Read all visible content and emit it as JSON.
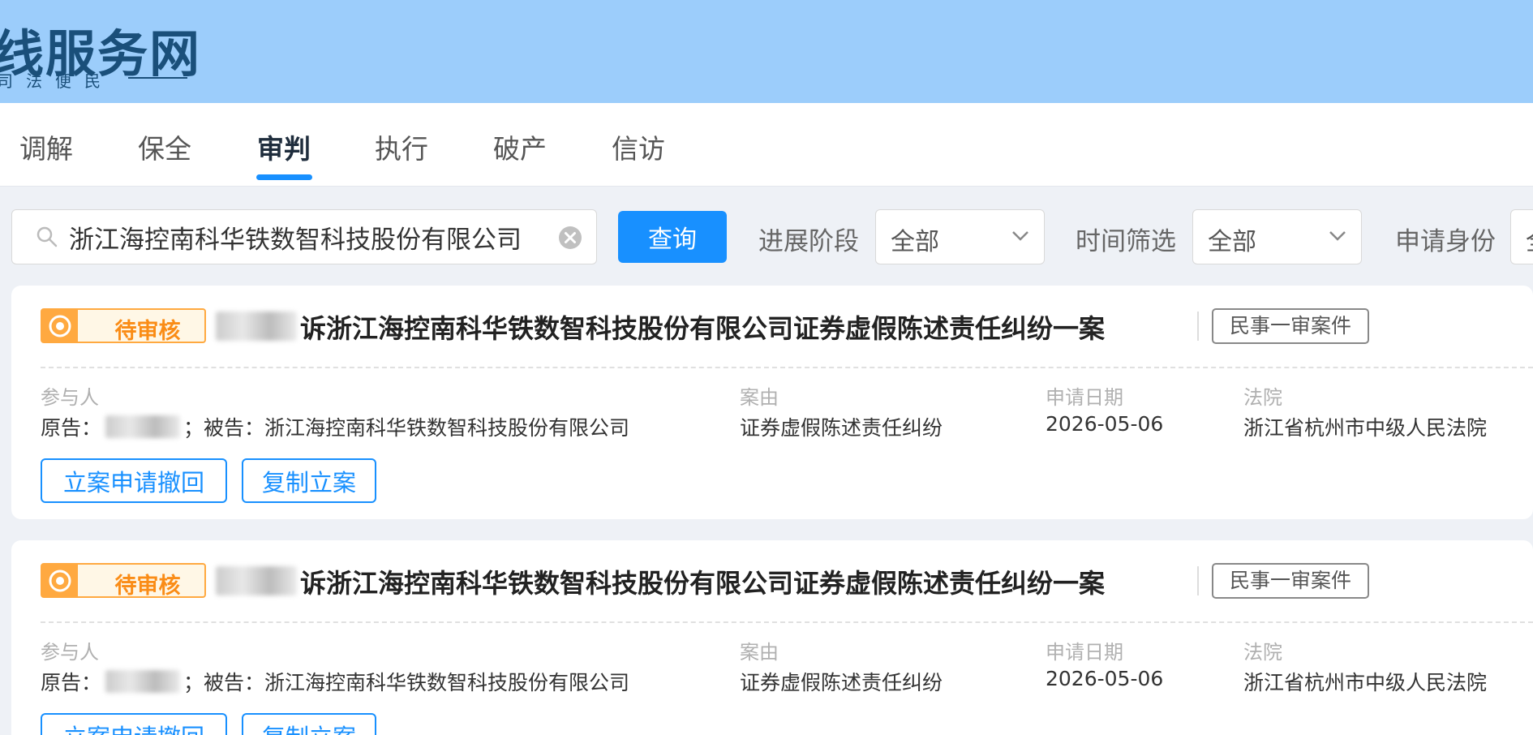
{
  "header": {
    "logo_title": "线服务网",
    "logo_subtitle": "司法便民"
  },
  "tabs": [
    {
      "label": "调解",
      "active": false
    },
    {
      "label": "保全",
      "active": false
    },
    {
      "label": "审判",
      "active": true
    },
    {
      "label": "执行",
      "active": false
    },
    {
      "label": "破产",
      "active": false
    },
    {
      "label": "信访",
      "active": false
    }
  ],
  "filters": {
    "search_value": "浙江海控南科华铁数智科技股份有限公司",
    "query_label": "查询",
    "stage_label": "进展阶段",
    "stage_value": "全部",
    "time_label": "时间筛选",
    "time_value": "全部",
    "identity_label": "申请身份",
    "identity_value": "全"
  },
  "cards": [
    {
      "status": "待审核",
      "title": "诉浙江海控南科华铁数智科技股份有限公司证券虚假陈述责任纠纷一案",
      "case_type": "民事一审案件",
      "participants_label": "参与人",
      "participants_prefix": "原告：",
      "participants_rest": "；被告：浙江海控南科华铁数智科技股份有限公司",
      "cause_label": "案由",
      "cause_value": "证券虚假陈述责任纠纷",
      "date_label": "申请日期",
      "date_value": "2026-05-06",
      "court_label": "法院",
      "court_value": "浙江省杭州市中级人民法院",
      "btn_withdraw": "立案申请撤回",
      "btn_copy": "复制立案"
    },
    {
      "status": "待审核",
      "title": "诉浙江海控南科华铁数智科技股份有限公司证券虚假陈述责任纠纷一案",
      "case_type": "民事一审案件",
      "participants_label": "参与人",
      "participants_prefix": "原告：",
      "participants_rest": "；被告：浙江海控南科华铁数智科技股份有限公司",
      "cause_label": "案由",
      "cause_value": "证券虚假陈述责任纠纷",
      "date_label": "申请日期",
      "date_value": "2026-05-06",
      "court_label": "法院",
      "court_value": "浙江省杭州市中级人民法院",
      "btn_withdraw": "立案申请撤回",
      "btn_copy": "复制立案"
    }
  ],
  "colors": {
    "header_bg": "#9ccdfb",
    "accent": "#1890ff",
    "status_orange": "#fa8c16"
  }
}
